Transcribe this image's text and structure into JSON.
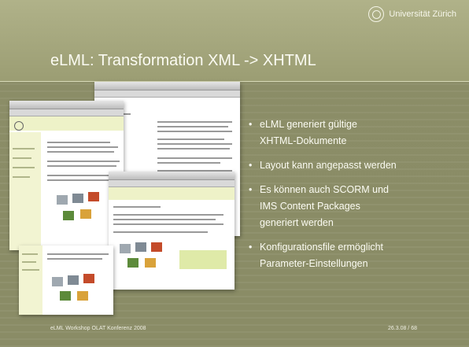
{
  "logo": {
    "text": "Universität Zürich"
  },
  "slide": {
    "title": "eLML: Transformation XML -> XHTML",
    "bullets": [
      {
        "line1": "eLML generiert gültige",
        "line2": "XHTML-Dokumente"
      },
      {
        "line1": "Layout kann angepasst werden",
        "line2": ""
      },
      {
        "line1": "Es können auch SCORM und",
        "line2": "IMS Content Packages",
        "line3": "generiert werden"
      },
      {
        "line1": "Konfigurationsfile ermöglicht",
        "line2": "Parameter-Einstellungen"
      }
    ]
  },
  "footer": {
    "left": "eLML Workshop OLAT Konferenz 2008",
    "right": "26.3.08  /  68"
  },
  "colors": {
    "background": "#8a8c66",
    "text": "#fbfbf2"
  }
}
